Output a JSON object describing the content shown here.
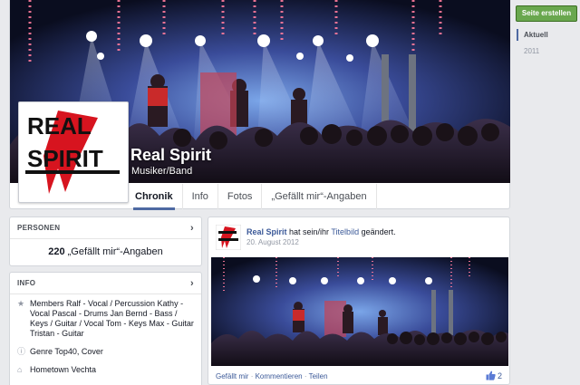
{
  "page": {
    "name": "Real Spirit",
    "category": "Musiker/Band"
  },
  "nav": {
    "tabs": [
      "Chronik",
      "Info",
      "Fotos",
      "„Gefällt mir“-Angaben"
    ]
  },
  "persons_box": {
    "heading": "PERSONEN",
    "likes_count": "220",
    "likes_label": "„Gefällt mir“-Angaben"
  },
  "info_box": {
    "heading": "INFO",
    "items": [
      {
        "icon": "star-icon",
        "text": "Members Ralf - Vocal / Percussion Kathy - Vocal Pascal - Drums Jan Bernd - Bass / Keys / Guitar / Vocal Tom - Keys Max - Guitar Tristan - Guitar"
      },
      {
        "icon": "info-icon",
        "text": "Genre Top40, Cover"
      },
      {
        "icon": "home-icon",
        "text": "Hometown Vechta"
      }
    ]
  },
  "post": {
    "author": "Real Spirit",
    "action_text": " hat sein/ihr ",
    "target": "Titelbild",
    "action_suffix": " geändert.",
    "date": "20. August 2012",
    "actions": [
      "Gefällt mir",
      "Kommentieren",
      "Teilen"
    ],
    "like_count": "2"
  },
  "right_rail": {
    "create_button": "Seite erstellen",
    "years": [
      "Aktuell",
      "2011"
    ]
  },
  "colors": {
    "accent": "#4e69a2",
    "link": "#3b5998",
    "create_button": "#69a74e",
    "logo_red": "#d7141f"
  }
}
